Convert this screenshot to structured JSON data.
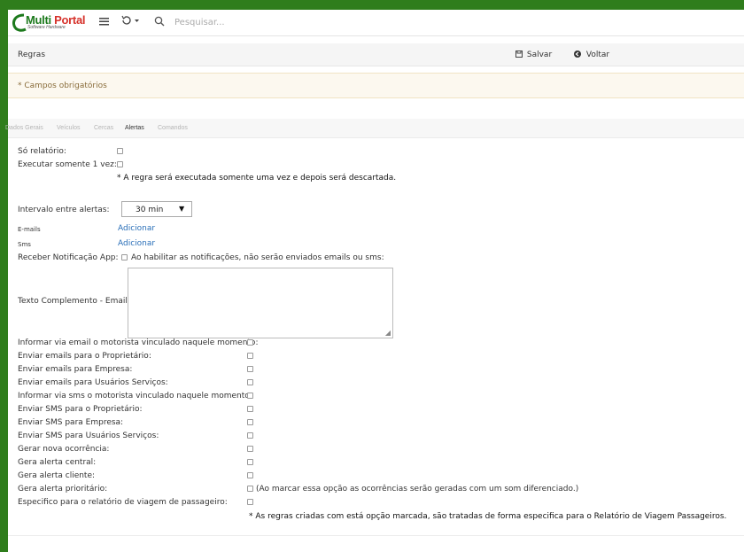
{
  "header": {
    "logo_main": "Multi",
    "logo_accent": "Portal",
    "logo_sub": "Software Hardware",
    "menu_icon": "hamburger-icon",
    "history_icon": "history-icon",
    "search_icon": "search-icon",
    "search_placeholder": "Pesquisar..."
  },
  "titlebar": {
    "title": "Regras",
    "save_label": "Salvar",
    "back_label": "Voltar"
  },
  "alert": {
    "text": "* Campos obrigatórios"
  },
  "tabs": [
    {
      "label": "Dados Gerais",
      "active": false
    },
    {
      "label": "Veículos",
      "active": false
    },
    {
      "label": "Cercas",
      "active": false
    },
    {
      "label": "Alertas",
      "active": true
    },
    {
      "label": "Comandos",
      "active": false
    }
  ],
  "form": {
    "so_relatorio": "Só relatório:",
    "executar_uma_vez": "Executar somente 1 vez:",
    "executar_note": "* A regra será executada somente uma vez e depois será descartada.",
    "intervalo_label": "Intervalo entre alertas:",
    "intervalo_value": "30 min",
    "emails_label": "E-mails",
    "emails_link": "Adicionar",
    "sms_label": "Sms",
    "sms_link": "Adicionar",
    "notif_label": "Receber Notificação App:",
    "notif_note": "Ao habilitar as notificações, não serão enviados emails ou sms:",
    "texto_label": "Texto Complemento - Email:",
    "rows": [
      "Informar via email o motorista vinculado naquele momento:",
      "Enviar emails para o Proprietário:",
      "Enviar emails para Empresa:",
      "Enviar emails para Usuários Serviços:",
      "Informar via sms o motorista vinculado naquele momento:",
      "Enviar SMS para o Proprietário:",
      "Enviar SMS para Empresa:",
      "Enviar SMS para Usuários Serviços:",
      "Gerar nova ocorrência:",
      "Gera alerta central:",
      "Gera alerta cliente:",
      "Gera alerta prioritário:",
      "Especifico para o relatório de viagem de passageiro:"
    ],
    "prioritario_note": "(Ao marcar essa opção as ocorrências serão geradas com um som diferenciado.)",
    "especifico_note": "* As regras criadas com está opção marcada, são tratadas de forma especifica para o Relatório de Viagem Passageiros."
  }
}
